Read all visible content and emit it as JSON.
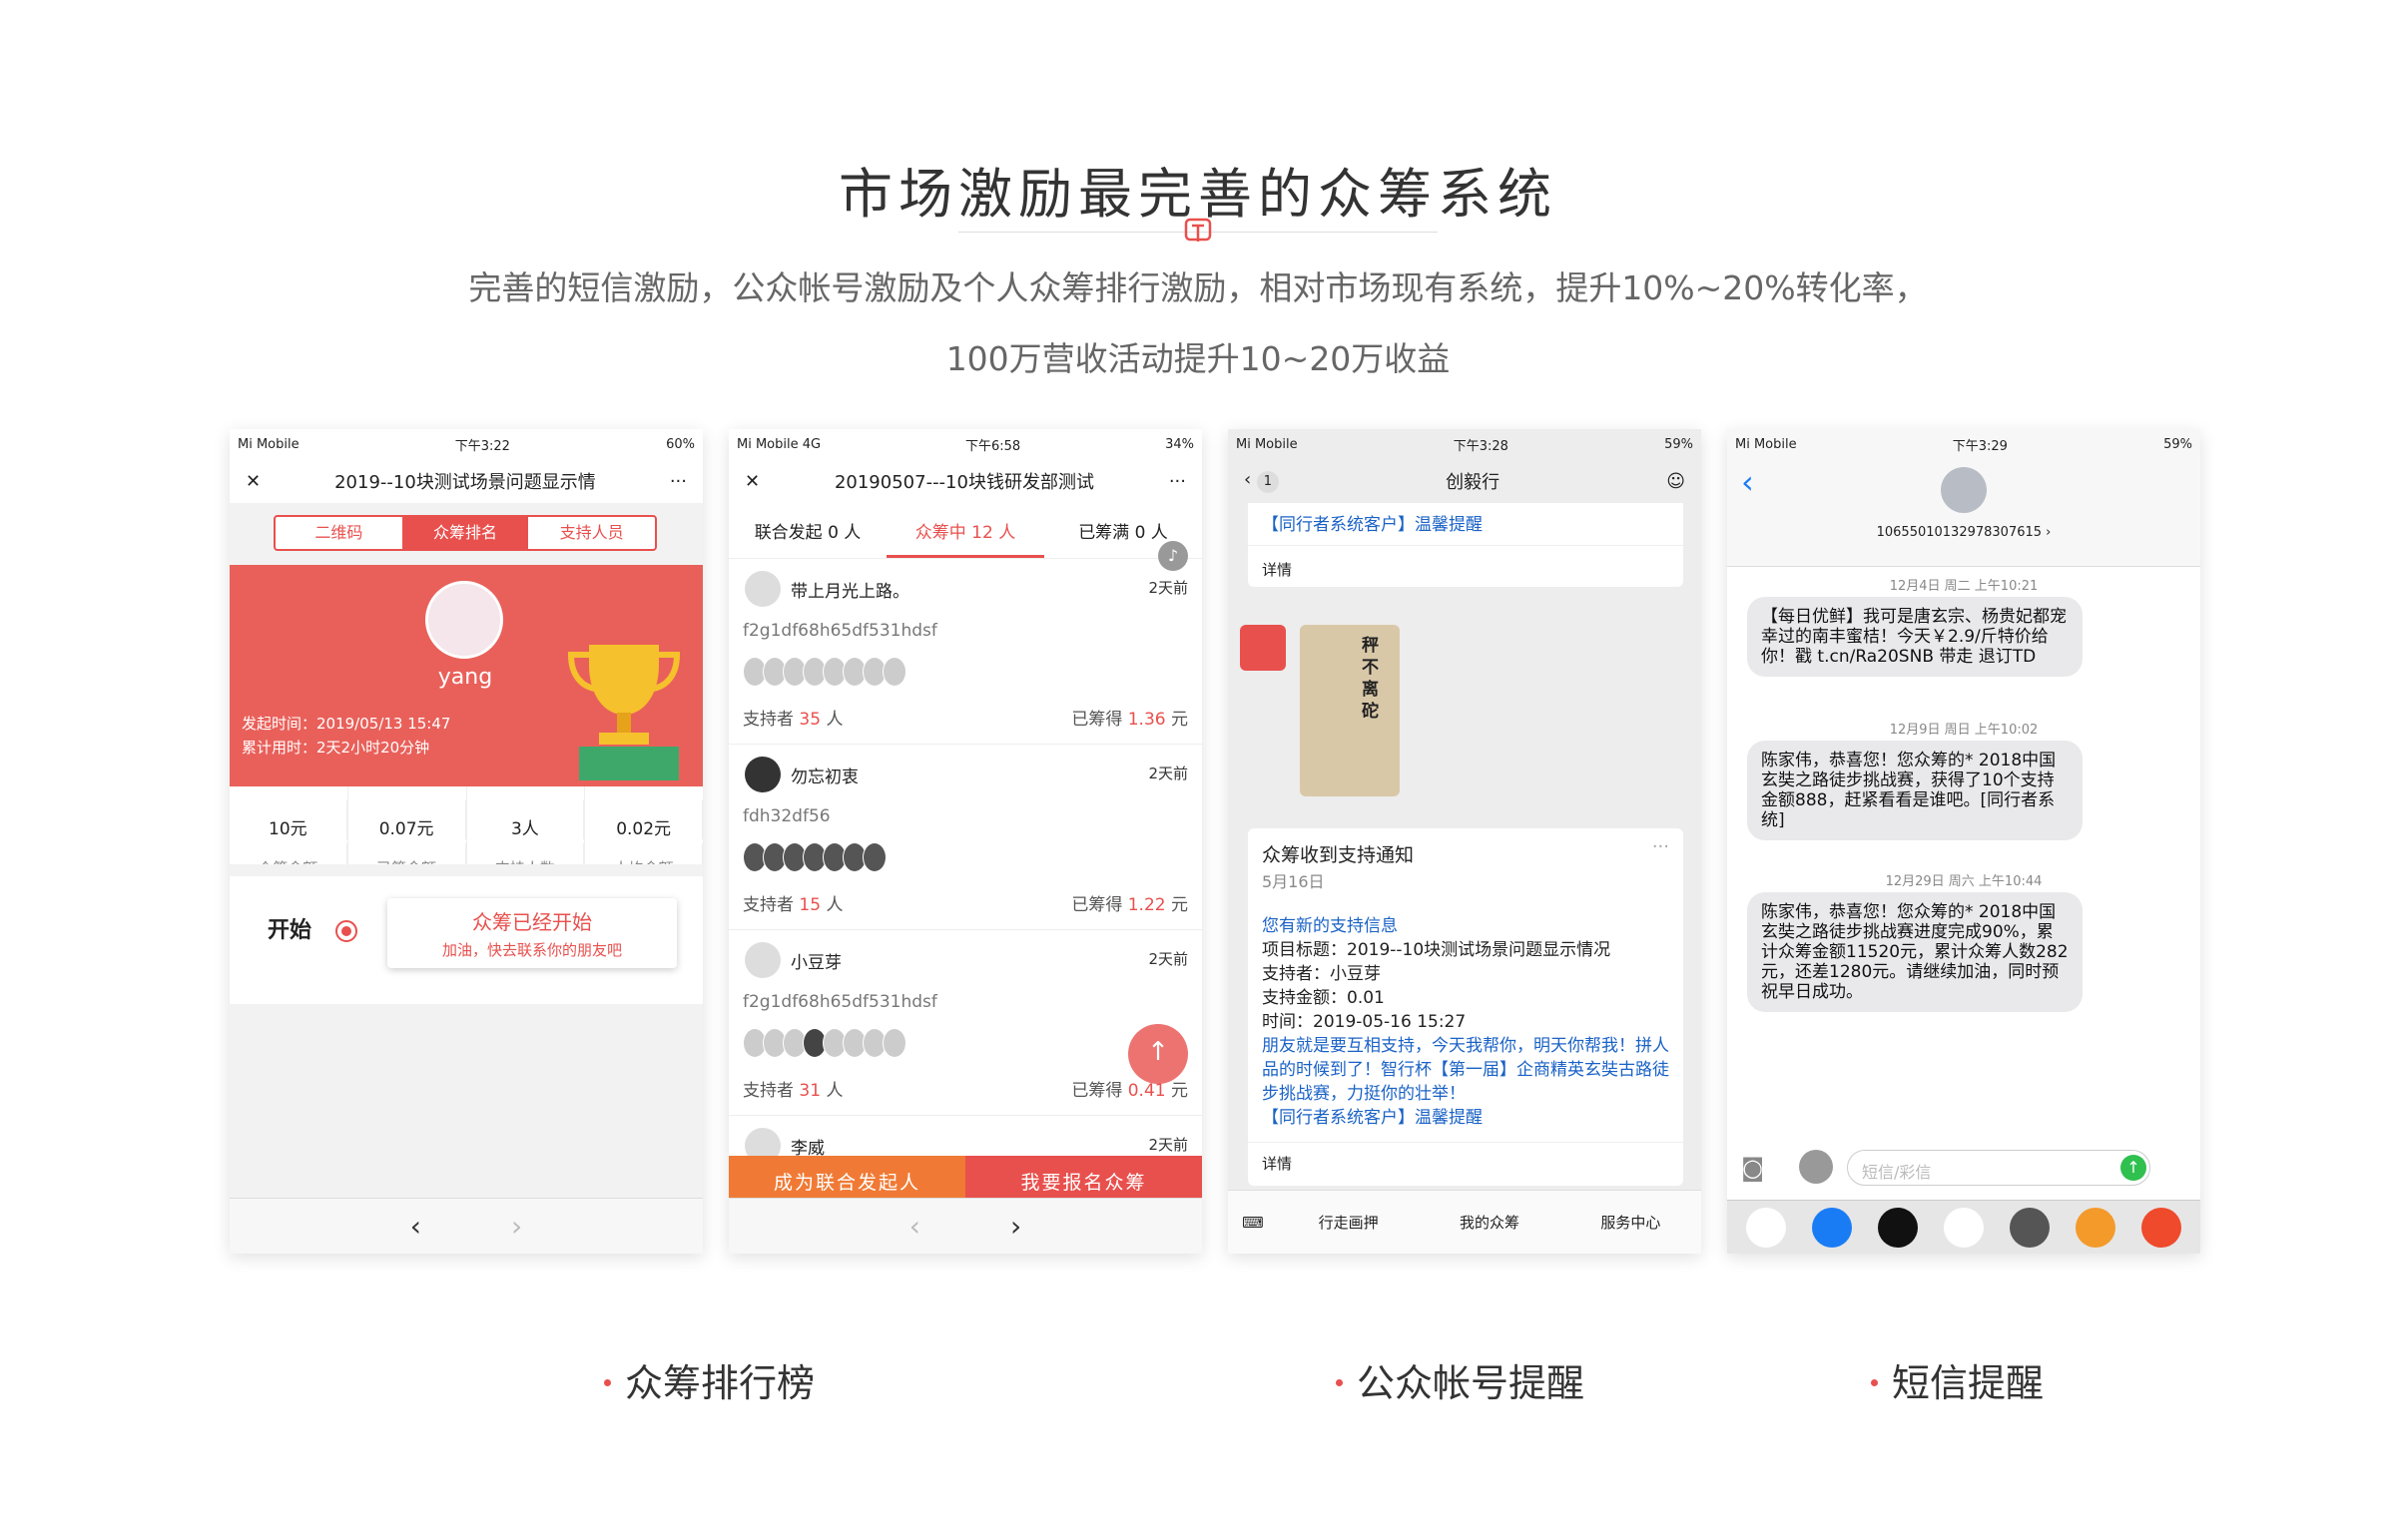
{
  "hero": {
    "title": "市场激励最完善的众筹系统",
    "subtitle1": "完善的短信激励，公众帐号激励及个人众筹排行激励，相对市场现有系统，提升10%~20%转化率，",
    "subtitle2": "100万营收活动提升10~20万收益"
  },
  "captions": [
    "众筹排行榜",
    "公众帐号提醒",
    "短信提醒"
  ],
  "colors": {
    "accent": "#e8504d",
    "link": "#1a62c6"
  },
  "p1": {
    "status": {
      "carrier": "Mi Mobile",
      "time": "下午3:22",
      "battery": "60%"
    },
    "title": "2019--10块测试场景问题显示情",
    "tabs": [
      "二维码",
      "众筹排名",
      "支持人员"
    ],
    "name": "yang",
    "start_time": "发起时间：2019/05/13 15:47",
    "elapsed": "累计用时：2天2小时20分钟",
    "stats": [
      {
        "v": "10元",
        "l": "众筹金额"
      },
      {
        "v": "0.07元",
        "l": "已筹金额"
      },
      {
        "v": "3人",
        "l": "支持人数"
      },
      {
        "v": "0.02元",
        "l": "人均金额"
      }
    ],
    "start_label": "开始",
    "notice_title": "众筹已经开始",
    "notice_sub": "加油，快去联系你的朋友吧"
  },
  "p2": {
    "status": {
      "carrier": "Mi Mobile 4G",
      "time": "下午6:58",
      "battery": "34%"
    },
    "title": "20190507---10块钱研发部测试",
    "tabs": [
      "联合发起 0 人",
      "众筹中 12 人",
      "已筹满 0 人"
    ],
    "items": [
      {
        "name": "带上月光上路。",
        "ago": "2天前",
        "code": "f2g1df68h65df531hdsf",
        "sup_pre": "支持者",
        "sup": "35",
        "sup_post": "人",
        "raised_pre": "已筹得",
        "raised": "1.36",
        "raised_post": "元"
      },
      {
        "name": "勿忘初衷",
        "ago": "2天前",
        "code": "fdh32df56",
        "sup_pre": "支持者",
        "sup": "15",
        "sup_post": "人",
        "raised_pre": "已筹得",
        "raised": "1.22",
        "raised_post": "元"
      },
      {
        "name": "小豆芽",
        "ago": "2天前",
        "code": "f2g1df68h65df531hdsf",
        "sup_pre": "支持者",
        "sup": "31",
        "sup_post": "人",
        "raised_pre": "已筹得",
        "raised": "0.41",
        "raised_post": "元"
      },
      {
        "name": "李威",
        "ago": "2天前"
      }
    ],
    "cta_left": "成为联合发起人",
    "cta_right": "我要报名众筹"
  },
  "p3": {
    "status": {
      "carrier": "Mi Mobile",
      "time": "下午3:28",
      "battery": "59%"
    },
    "title": "创毅行",
    "badge": "1",
    "prev_link": "【同行者系统客户】温馨提醒",
    "detail": "详情",
    "card_title": "众筹收到支持通知",
    "card_date": "5月16日",
    "lines": [
      "您有新的支持信息",
      "项目标题：2019--10块测试场景问题显示情况",
      "支持者：小豆芽",
      "支持金额：0.01",
      "时间：2019-05-16 15:27",
      "朋友就是要互相支持，今天我帮你，明天你帮我！拼人品的时候到了！智行杯【第一届】企商精英玄奘古路徒步挑战赛，力挺你的壮举！",
      "【同行者系统客户】温馨提醒"
    ],
    "tabs": [
      "行走画押",
      "我的众筹",
      "服务中心"
    ],
    "poster_text": "秤不离砣"
  },
  "p4": {
    "status": {
      "carrier": "Mi Mobile",
      "time": "下午3:29",
      "battery": "59%"
    },
    "sender": "10655010132978307615 ›",
    "messages": [
      {
        "ts": "12月4日 周二 上午10:21",
        "text": "【每日优鲜】我可是唐玄宗、杨贵妃都宠幸过的南丰蜜桔！今天￥2.9/斤特价给你！戳 t.cn/Ra20SNB 带走 退订TD"
      },
      {
        "ts": "12月9日 周日 上午10:02",
        "text": "陈家伟，恭喜您！您众筹的* 2018中国玄奘之路徒步挑战赛，获得了10个支持金额888，赶紧看看是谁吧。[同行者系统]"
      },
      {
        "ts": "12月29日 周六 上午10:44",
        "text": "陈家伟，恭喜您！您众筹的* 2018中国玄奘之路徒步挑战赛进度完成90%，累计众筹金额11520元，累计众筹人数282元，还差1280元。请继续加油，同时预祝早日成功。"
      }
    ],
    "input_placeholder": "短信/彩信"
  }
}
